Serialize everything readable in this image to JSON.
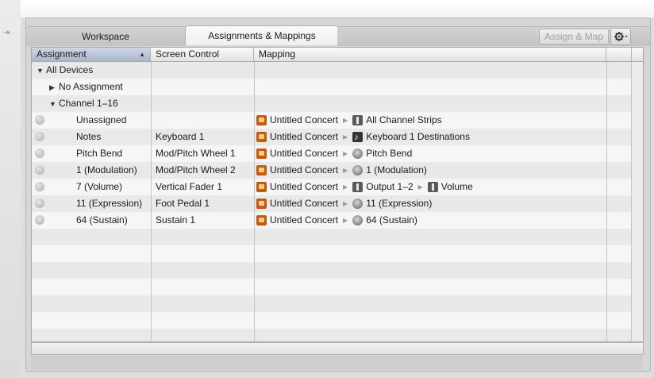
{
  "tabs": [
    {
      "label": "Workspace",
      "active": false
    },
    {
      "label": "Assignments & Mappings",
      "active": true
    }
  ],
  "toolbar": {
    "assign_map_label": "Assign & Map",
    "assign_map_enabled": false,
    "gear_icon": "gear-icon"
  },
  "table": {
    "columns": [
      "Assignment",
      "Screen Control",
      "Mapping"
    ],
    "sorted_column": "Assignment",
    "tree": [
      {
        "label": "All Devices",
        "level": 0,
        "expanded": true
      },
      {
        "label": "No Assignment",
        "level": 1,
        "expanded": false
      },
      {
        "label": "Channel 1–16",
        "level": 1,
        "expanded": true
      }
    ],
    "rows": [
      {
        "assignment": "Unassigned",
        "screen_control": "",
        "concert": "Untitled Concert",
        "target_icon": "channel-strip-icon",
        "target": "All Channel Strips",
        "extra": ""
      },
      {
        "assignment": "Notes",
        "screen_control": "Keyboard 1",
        "concert": "Untitled Concert",
        "target_icon": "keyboard-icon",
        "target": "Keyboard 1 Destinations",
        "extra": ""
      },
      {
        "assignment": "Pitch Bend",
        "screen_control": "Mod/Pitch Wheel 1",
        "concert": "Untitled Concert",
        "target_icon": "knob-icon",
        "target": "Pitch Bend",
        "extra": ""
      },
      {
        "assignment": "1 (Modulation)",
        "screen_control": "Mod/Pitch Wheel 2",
        "concert": "Untitled Concert",
        "target_icon": "knob-icon",
        "target": "1 (Modulation)",
        "extra": ""
      },
      {
        "assignment": "7 (Volume)",
        "screen_control": "Vertical Fader 1",
        "concert": "Untitled Concert",
        "target_icon": "channel-strip-icon",
        "target": "Output 1–2",
        "extra": "Volume"
      },
      {
        "assignment": "11 (Expression)",
        "screen_control": "Foot Pedal 1",
        "concert": "Untitled Concert",
        "target_icon": "knob-icon",
        "target": "11 (Expression)",
        "extra": ""
      },
      {
        "assignment": "64 (Sustain)",
        "screen_control": "Sustain 1",
        "concert": "Untitled Concert",
        "target_icon": "knob-icon",
        "target": "64 (Sustain)",
        "extra": ""
      }
    ]
  }
}
